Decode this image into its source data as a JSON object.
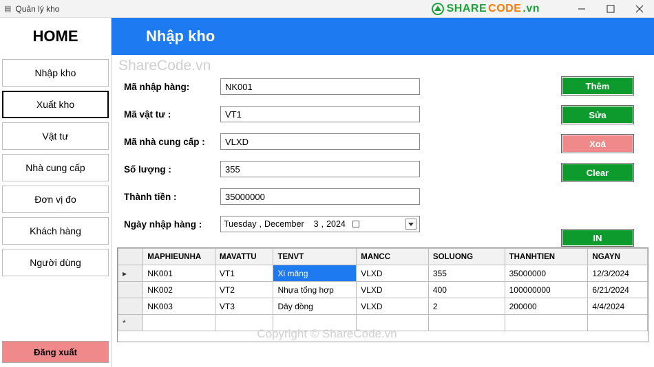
{
  "window": {
    "title": "Quản lý kho",
    "brand": {
      "text_share": "SHARE",
      "text_code": "CODE",
      "tld": ".vn"
    }
  },
  "sidebar": {
    "home": "HOME",
    "items": [
      {
        "label": "Nhập kho",
        "active": false
      },
      {
        "label": "Xuất kho",
        "active": true
      },
      {
        "label": "Vật tư",
        "active": false
      },
      {
        "label": "Nhà cung cấp",
        "active": false
      },
      {
        "label": "Đơn vị đo",
        "active": false
      },
      {
        "label": "Khách hàng",
        "active": false
      },
      {
        "label": "Người dùng",
        "active": false
      }
    ],
    "logout": "Đăng xuất"
  },
  "header": {
    "title": "Nhập kho"
  },
  "watermarks": {
    "top": "ShareCode.vn",
    "bottom": "Copyright © ShareCode.vn"
  },
  "form": {
    "ma_nhap_hang": {
      "label": "Mã nhập hàng:",
      "value": "NK001"
    },
    "ma_vat_tu": {
      "label": "Mã vật tư :",
      "value": "VT1"
    },
    "ma_ncc": {
      "label": "Mã nhà cung cấp :",
      "value": "VLXD"
    },
    "so_luong": {
      "label": "Số lượng :",
      "value": "355"
    },
    "thanh_tien": {
      "label": "Thành tiền :",
      "value": "35000000"
    },
    "ngay_nhap": {
      "label": "Ngày nhập hàng :",
      "weekday": "Tuesday",
      "sep": ",",
      "month": "December",
      "day": "3",
      "year": "2024"
    }
  },
  "actions": {
    "add": "Thêm",
    "edit": "Sửa",
    "del": "Xoá",
    "clear": "Clear",
    "print": "IN"
  },
  "grid": {
    "columns": [
      "MAPHIEUNHA",
      "MAVATTU",
      "TENVT",
      "MANCC",
      "SOLUONG",
      "THANHTIEN",
      "NGAYN"
    ],
    "rows": [
      {
        "maphieunha": "NK001",
        "mavattu": "VT1",
        "tenvt": "Xi măng",
        "mancc": "VLXD",
        "soluong": "355",
        "thanhtien": "35000000",
        "ngayn": "12/3/2024"
      },
      {
        "maphieunha": "NK002",
        "mavattu": "VT2",
        "tenvt": "Nhựa tổng hợp",
        "mancc": "VLXD",
        "soluong": "400",
        "thanhtien": "100000000",
        "ngayn": "6/21/2024"
      },
      {
        "maphieunha": "NK003",
        "mavattu": "VT3",
        "tenvt": "Dây đồng",
        "mancc": "VLXD",
        "soluong": "2",
        "thanhtien": "200000",
        "ngayn": "4/4/2024"
      }
    ],
    "selected": {
      "row": 0,
      "col": "tenvt"
    }
  }
}
